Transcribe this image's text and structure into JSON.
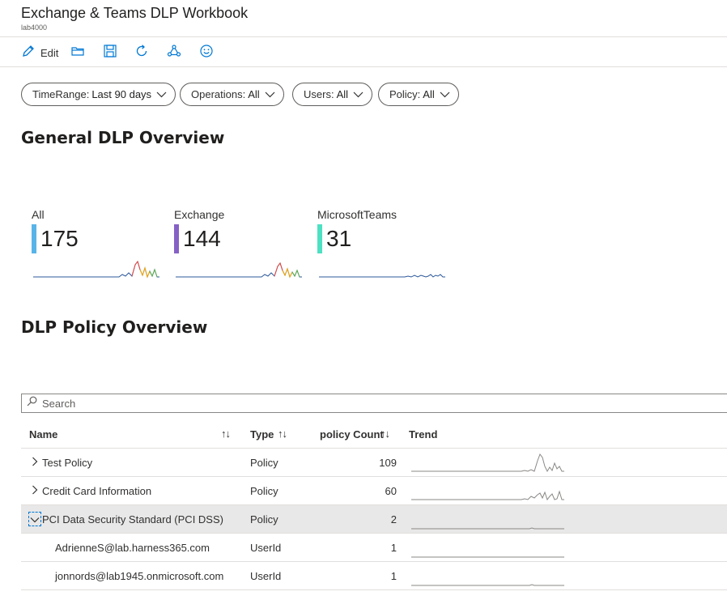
{
  "header": {
    "title": "Exchange & Teams DLP Workbook",
    "subtitle": "lab4000"
  },
  "toolbar": {
    "edit_label": "Edit",
    "icons": [
      "edit-icon",
      "open-folder-icon",
      "save-icon",
      "refresh-icon",
      "share-icon",
      "feedback-smiley-icon"
    ]
  },
  "filters": [
    {
      "name": "TimeRange:",
      "value": "Last 90 days"
    },
    {
      "name": "Operations:",
      "value": "All"
    },
    {
      "name": "Users:",
      "value": "All"
    },
    {
      "name": "Policy:",
      "value": "All"
    }
  ],
  "sections": {
    "general": "General DLP Overview",
    "policy": "DLP Policy Overview"
  },
  "tiles": [
    {
      "label": "All",
      "value": "175",
      "color": "#58b4e8"
    },
    {
      "label": "Exchange",
      "value": "144",
      "color": "#8661c5"
    },
    {
      "label": "MicrosoftTeams",
      "value": "31",
      "color": "#4ee0c3"
    }
  ],
  "search": {
    "placeholder": "Search",
    "value": ""
  },
  "table": {
    "columns": [
      "Name",
      "Type",
      "policy Count",
      "Trend"
    ],
    "sort_glyph": "↑↓",
    "rows": [
      {
        "name": "Test Policy",
        "type": "Policy",
        "count": "109",
        "expandable": true,
        "expanded": false
      },
      {
        "name": "Credit Card Information",
        "type": "Policy",
        "count": "60",
        "expandable": true,
        "expanded": false
      },
      {
        "name": "PCI Data Security Standard (PCI DSS)",
        "type": "Policy",
        "count": "2",
        "expandable": true,
        "expanded": true,
        "selected": true
      },
      {
        "name": "AdrienneS@lab.harness365.com",
        "type": "UserId",
        "count": "1",
        "child": true
      },
      {
        "name": "jonnords@lab1945.onmicrosoft.com",
        "type": "UserId",
        "count": "1",
        "child": true
      }
    ]
  },
  "colors": {
    "accent": "#0078d4",
    "selected_row": "#e8e8e8"
  }
}
